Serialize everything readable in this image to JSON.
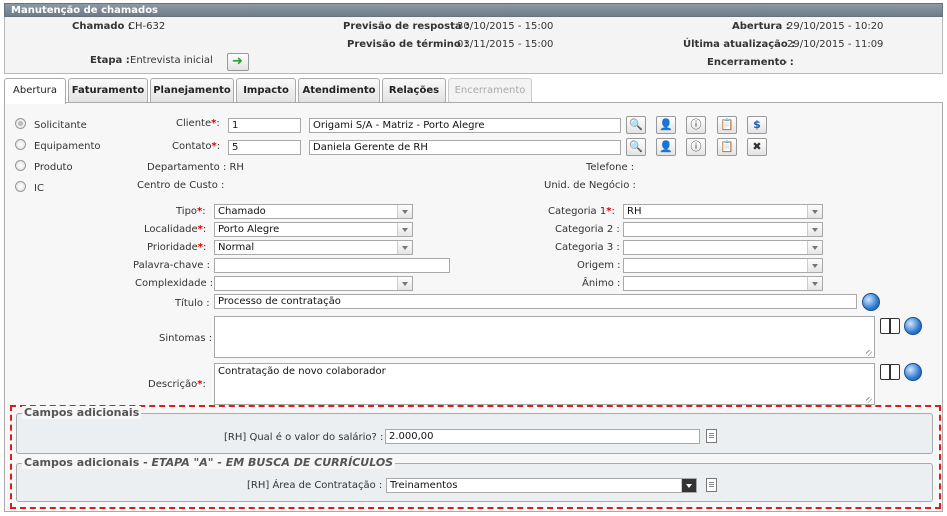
{
  "window": {
    "title": "Manutenção de chamados"
  },
  "header": {
    "chamado_label": "Chamado :",
    "chamado_value": "CH-632",
    "previsao_resposta_label": "Previsão de resposta :",
    "previsao_resposta_value": "30/10/2015 - 15:00",
    "abertura_label": "Abertura :",
    "abertura_value": "29/10/2015 - 10:20",
    "previsao_termino_label": "Previsão de término :",
    "previsao_termino_value": "03/11/2015 - 15:00",
    "ultima_atualizacao_label": "Última atualização :",
    "ultima_atualizacao_value": "29/10/2015 - 11:09",
    "etapa_label": "Etapa :",
    "etapa_value": "Entrevista inicial",
    "encerramento_label": "Encerramento :",
    "encerramento_value": "-"
  },
  "tabs": [
    {
      "label": "Abertura"
    },
    {
      "label": "Faturamento"
    },
    {
      "label": "Planejamento"
    },
    {
      "label": "Impacto"
    },
    {
      "label": "Atendimento"
    },
    {
      "label": "Relações"
    },
    {
      "label": "Encerramento"
    }
  ],
  "radio": {
    "solicitante": "Solicitante",
    "equipamento": "Equipamento",
    "produto": "Produto",
    "ic": "IC"
  },
  "form": {
    "cliente_label": "Cliente",
    "cliente_code": "1",
    "cliente_name": "Origami S/A - Matriz - Porto Alegre",
    "contato_label": "Contato",
    "contato_code": "5",
    "contato_name": "Daniela Gerente de RH",
    "departamento": "Departamento : RH",
    "telefone": "Telefone :",
    "centro_custo": "Centro de Custo :",
    "unid_negocio": "Unid. de Negócio :",
    "tipo_label": "Tipo",
    "tipo_value": "Chamado",
    "localidade_label": "Localidade",
    "localidade_value": "Porto Alegre",
    "prioridade_label": "Prioridade",
    "prioridade_value": "Normal",
    "palavra_chave_label": "Palavra-chave :",
    "complexidade_label": "Complexidade :",
    "categoria1_label": "Categoria 1",
    "categoria1_value": "RH",
    "categoria2_label": "Categoria 2 :",
    "categoria3_label": "Categoria 3 :",
    "origem_label": "Origem :",
    "animo_label": "Ânimo :",
    "titulo_label": "Título :",
    "titulo_value": "Processo de contratação",
    "sintomas_label": "Sintomas :",
    "descricao_label": "Descrição",
    "descricao_value": "Contratação de novo colaborador",
    "colon": ":",
    "req": "*"
  },
  "extra": {
    "legend1": "Campos adicionais",
    "q1_label": "[RH] Qual é o valor do salário? :",
    "q1_value": "2.000,00",
    "legend2_prefix": "Campos adicionais - ",
    "legend2_stage": "ETAPA \"A\" - EM BUSCA DE CURRÍCULOS",
    "q2_label": "[RH] Área de Contratação :",
    "q2_value": "Treinamentos"
  }
}
